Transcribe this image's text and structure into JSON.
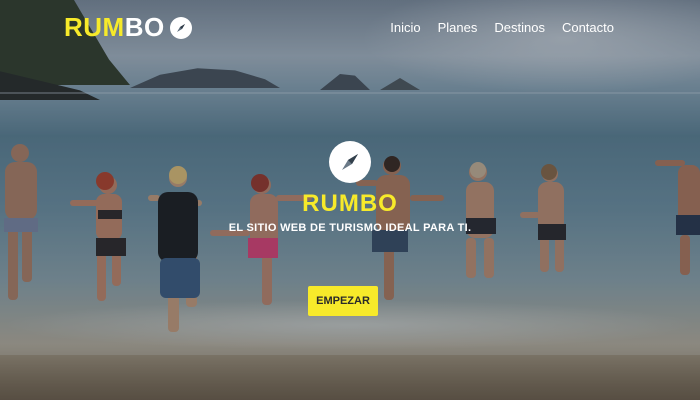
{
  "brand": {
    "logo_part1": "RUM",
    "logo_part2": "BO",
    "title": "RUMBO",
    "tagline": "EL SITIO WEB DE TURISMO IDEAL PARA TI.",
    "accent_color": "#f7ea2a"
  },
  "nav": {
    "items": [
      {
        "label": "Inicio"
      },
      {
        "label": "Planes"
      },
      {
        "label": "Destinos"
      },
      {
        "label": "Contacto"
      }
    ]
  },
  "hero": {
    "cta_label": "EMPEZAR",
    "icon": "compass-icon",
    "background": "photo of people running into the sea"
  }
}
